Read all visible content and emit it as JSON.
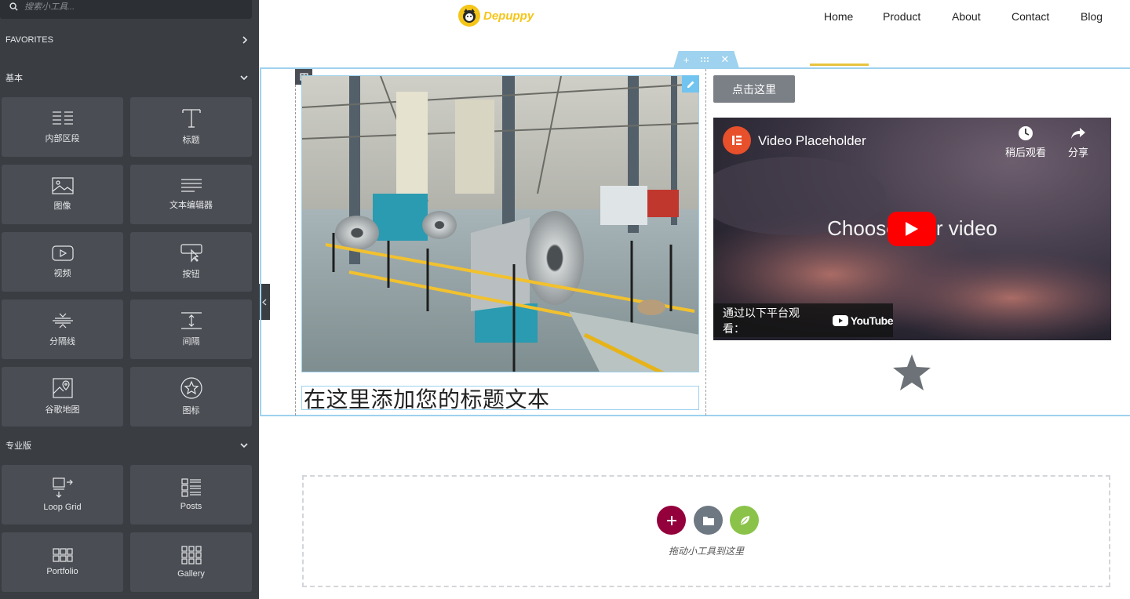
{
  "sidebar": {
    "search_placeholder": "搜索小工具...",
    "favorites_label": "FAVORITES",
    "basic_label": "基本",
    "pro_label": "专业版",
    "basic_widgets": [
      {
        "label": "内部区段",
        "icon": "inner-section-icon"
      },
      {
        "label": "标题",
        "icon": "heading-icon"
      },
      {
        "label": "图像",
        "icon": "image-icon"
      },
      {
        "label": "文本编辑器",
        "icon": "text-editor-icon"
      },
      {
        "label": "视频",
        "icon": "video-icon"
      },
      {
        "label": "按钮",
        "icon": "button-icon"
      },
      {
        "label": "分隔线",
        "icon": "divider-icon"
      },
      {
        "label": "间隔",
        "icon": "spacer-icon"
      },
      {
        "label": "谷歌地图",
        "icon": "google-maps-icon"
      },
      {
        "label": "图标",
        "icon": "star-icon"
      }
    ],
    "pro_widgets": [
      {
        "label": "Loop Grid",
        "icon": "loop-grid-icon"
      },
      {
        "label": "Posts",
        "icon": "posts-icon"
      },
      {
        "label": "Portfolio",
        "icon": "portfolio-icon"
      },
      {
        "label": "Gallery",
        "icon": "gallery-icon"
      }
    ]
  },
  "header": {
    "brand": "Depuppy",
    "nav": [
      "Home",
      "Product",
      "About",
      "Contact",
      "Blog"
    ]
  },
  "content": {
    "heading": "在这里添加您的标题文本",
    "button_label": "点击这里",
    "video": {
      "title": "Video Placeholder",
      "center_text": "Choose your video",
      "watch_later": "稍后观看",
      "share": "分享",
      "watch_on": "通过以下平台观看：",
      "platform": "YouTube"
    }
  },
  "dropzone": {
    "hint": "拖动小工具到这里"
  },
  "colors": {
    "sidebar_bg": "#3a3d42",
    "accent_blue": "#9ed2ee",
    "add_button": "#93003c",
    "template_button": "#6d7882",
    "ai_button": "#8bc34a"
  }
}
